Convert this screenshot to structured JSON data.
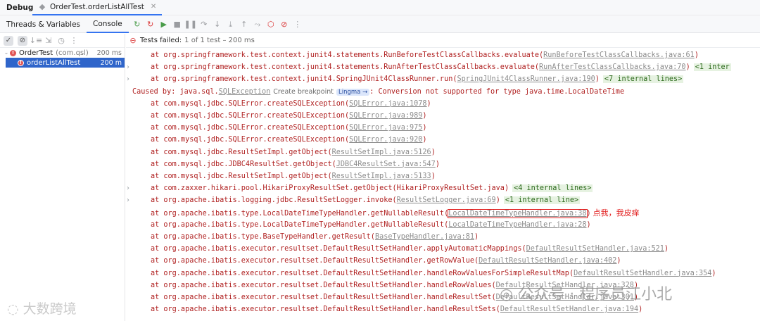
{
  "topbar": {
    "title": "Debug",
    "tab_label": "OrderTest.orderListAllTest"
  },
  "toolbar": {
    "tabs": [
      "Threads & Variables",
      "Console"
    ],
    "active_tab": "Console"
  },
  "status": {
    "icon": "stop-circle-icon",
    "failed": "Tests failed:",
    "detail": "1 of 1 test – 200 ms"
  },
  "tree": [
    {
      "label": "OrderTest",
      "sub": "(com.qsl)",
      "time": "200 ms",
      "selected": false
    },
    {
      "label": "orderListAllTest",
      "sub": "",
      "time": "200 m",
      "selected": true
    }
  ],
  "console_lines": [
    {
      "fold": false,
      "pre": "at org.springframework.test.context.junit4.statements.RunBeforeTestClassCallbacks.evaluate(",
      "link": "RunBeforeTestClassCallbacks.java:61",
      "post": ")",
      "internal": ""
    },
    {
      "fold": true,
      "pre": "at org.springframework.test.context.junit4.statements.RunAfterTestClassCallbacks.evaluate(",
      "link": "RunAfterTestClassCallbacks.java:70",
      "post": ")",
      "internal": "<1 inter"
    },
    {
      "fold": true,
      "pre": "at org.springframework.test.context.junit4.SpringJUnit4ClassRunner.run(",
      "link": "SpringJUnit4ClassRunner.java:190",
      "post": ")",
      "internal": "<7 internal lines>"
    },
    {
      "fold": false,
      "caused": true,
      "pre": "Caused by: java.sql.",
      "link": "SQLException",
      "breakpoint": "Create breakpoint",
      "lingma": "Lingma →",
      "post": ": Conversion not supported for type java.time.LocalDateTime",
      "internal": ""
    },
    {
      "fold": false,
      "pre": "at com.mysql.jdbc.SQLError.createSQLException(",
      "link": "SQLError.java:1078",
      "post": ")",
      "internal": ""
    },
    {
      "fold": false,
      "pre": "at com.mysql.jdbc.SQLError.createSQLException(",
      "link": "SQLError.java:989",
      "post": ")",
      "internal": ""
    },
    {
      "fold": false,
      "pre": "at com.mysql.jdbc.SQLError.createSQLException(",
      "link": "SQLError.java:975",
      "post": ")",
      "internal": ""
    },
    {
      "fold": false,
      "pre": "at com.mysql.jdbc.SQLError.createSQLException(",
      "link": "SQLError.java:920",
      "post": ")",
      "internal": ""
    },
    {
      "fold": false,
      "pre": "at com.mysql.jdbc.ResultSetImpl.getObject(",
      "link": "ResultSetImpl.java:5126",
      "post": ")",
      "internal": ""
    },
    {
      "fold": false,
      "pre": "at com.mysql.jdbc.JDBC4ResultSet.getObject(",
      "link": "JDBC4ResultSet.java:547",
      "post": ")",
      "internal": ""
    },
    {
      "fold": false,
      "pre": "at com.mysql.jdbc.ResultSetImpl.getObject(",
      "link": "ResultSetImpl.java:5133",
      "post": ")",
      "internal": ""
    },
    {
      "fold": true,
      "pre": "at com.zaxxer.hikari.pool.HikariProxyResultSet.getObject(HikariProxyResultSet.java)",
      "link": "",
      "post": "",
      "internal": "<4 internal lines>"
    },
    {
      "fold": true,
      "pre": "at org.apache.ibatis.logging.jdbc.ResultSetLogger.invoke(",
      "link": "ResultSetLogger.java:69",
      "post": ")",
      "internal": "<1 internal line>"
    },
    {
      "fold": false,
      "highlight": true,
      "pre": "at org.apache.ibatis.type.LocalDateTimeTypeHandler.getNullableResult(",
      "link": "LocalDateTimeTypeHandler.java:38",
      "post": ")",
      "internal": "",
      "annotation": "点我，我皮痒"
    },
    {
      "fold": false,
      "pre": "at org.apache.ibatis.type.LocalDateTimeTypeHandler.getNullableResult(",
      "link": "LocalDateTimeTypeHandler.java:28",
      "post": ")",
      "internal": ""
    },
    {
      "fold": false,
      "pre": "at org.apache.ibatis.type.BaseTypeHandler.getResult(",
      "link": "BaseTypeHandler.java:81",
      "post": ")",
      "internal": ""
    },
    {
      "fold": false,
      "pre": "at org.apache.ibatis.executor.resultset.DefaultResultSetHandler.applyAutomaticMappings(",
      "link": "DefaultResultSetHandler.java:521",
      "post": ")",
      "internal": ""
    },
    {
      "fold": false,
      "pre": "at org.apache.ibatis.executor.resultset.DefaultResultSetHandler.getRowValue(",
      "link": "DefaultResultSetHandler.java:402",
      "post": ")",
      "internal": ""
    },
    {
      "fold": false,
      "pre": "at org.apache.ibatis.executor.resultset.DefaultResultSetHandler.handleRowValuesForSimpleResultMap(",
      "link": "DefaultResultSetHandler.java:354",
      "post": ")",
      "internal": ""
    },
    {
      "fold": false,
      "pre": "at org.apache.ibatis.executor.resultset.DefaultResultSetHandler.handleRowValues(",
      "link": "DefaultResultSetHandler.java:328",
      "post": ")",
      "internal": ""
    },
    {
      "fold": false,
      "pre": "at org.apache.ibatis.executor.resultset.DefaultResultSetHandler.handleResultSet(",
      "link": "DefaultResultSetHandler.java:301",
      "post": ")",
      "internal": ""
    },
    {
      "fold": false,
      "pre": "at org.apache.ibatis.executor.resultset.DefaultResultSetHandler.handleResultSets(",
      "link": "DefaultResultSetHandler.java:194",
      "post": ")",
      "internal": ""
    }
  ],
  "watermarks": {
    "left": "大数跨境",
    "right": "公众号 · 程序员江小北"
  },
  "colors": {
    "accent": "#3574f0",
    "error": "#b02121",
    "highlight_box": "#e21e1e",
    "selected_row": "#2f65ca"
  }
}
